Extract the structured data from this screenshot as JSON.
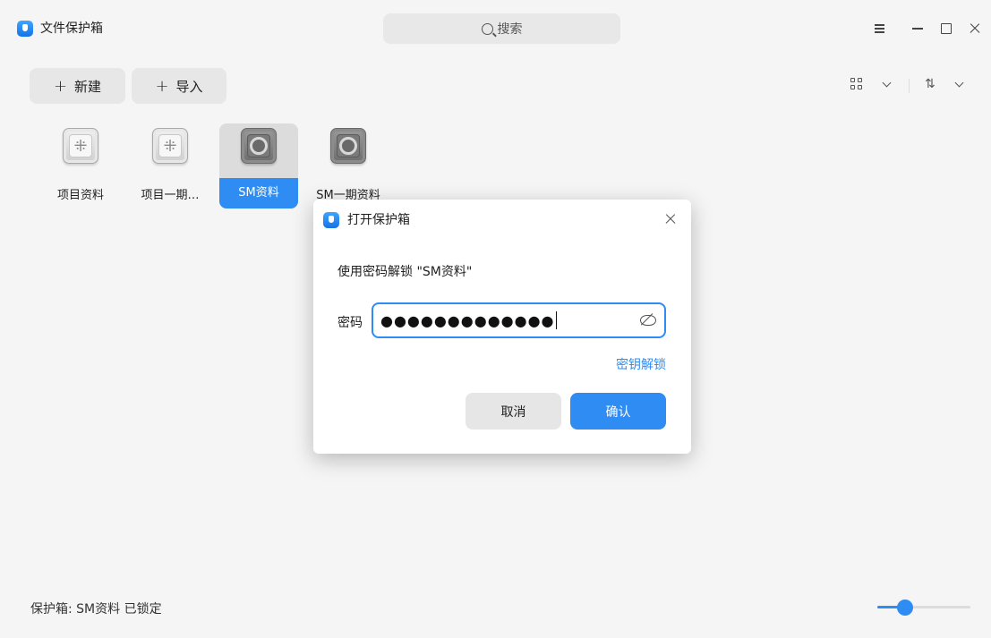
{
  "app": {
    "title": "文件保护箱"
  },
  "search": {
    "placeholder": "搜索"
  },
  "toolbar": {
    "new_label": "新建",
    "import_label": "导入",
    "plus_glyph": "+"
  },
  "vaults": [
    {
      "name": "项目资料",
      "state": "unlocked",
      "selected": false
    },
    {
      "name": "项目一期…",
      "state": "unlocked",
      "selected": false
    },
    {
      "name": "SM资料",
      "state": "locked",
      "selected": true
    },
    {
      "name": "SM一期资料",
      "state": "locked",
      "selected": false
    }
  ],
  "dialog": {
    "title": "打开保护箱",
    "prompt": "使用密码解锁 \"SM资料\"",
    "password_label": "密码",
    "password_value": "●●●●●●●●●●●●●",
    "key_unlock_link": "密钥解锁",
    "cancel_label": "取消",
    "confirm_label": "确认"
  },
  "status": {
    "text": "保护箱: SM资料  已锁定"
  },
  "icon_slider": {
    "value": 0.3
  },
  "colors": {
    "accent": "#2f8cf2",
    "background": "#f5f5f5"
  }
}
